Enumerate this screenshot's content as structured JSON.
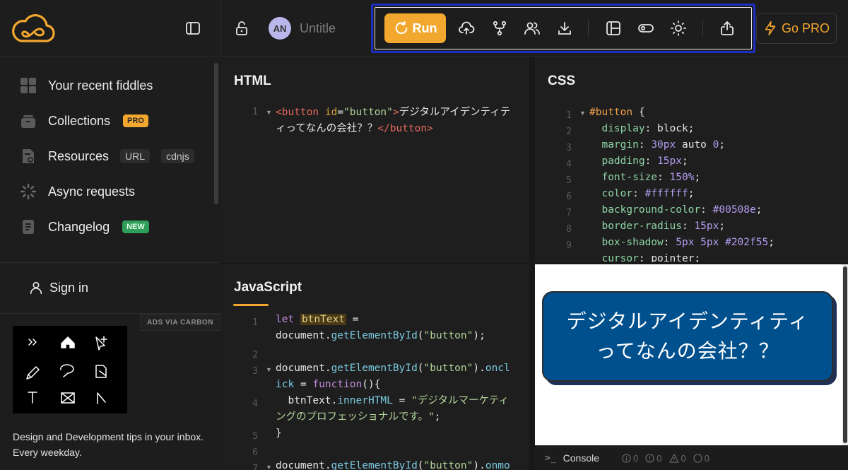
{
  "header": {
    "avatar_initials": "AN",
    "title": "Untitle",
    "run_label": "Run",
    "gopro_label": "Go PRO",
    "toolbar_icons": [
      "upload-icon",
      "fork-icon",
      "collaborate-icon",
      "download-icon",
      "layout-icon",
      "toggle-icon",
      "theme-sun-icon",
      "share-icon"
    ]
  },
  "sidebar": {
    "items": [
      {
        "label": "Your recent fiddles"
      },
      {
        "label": "Collections",
        "badge": "PRO"
      },
      {
        "label": "Resources",
        "chips": [
          "URL",
          "cdnjs"
        ]
      },
      {
        "label": "Async requests"
      },
      {
        "label": "Changelog",
        "badge": "NEW"
      }
    ],
    "signin_label": "Sign in",
    "ads_label": "ADS VIA CARBON",
    "ad_text": "Design and Development tips in your inbox. Every weekday."
  },
  "panels": {
    "html_title": "HTML",
    "css_title": "CSS",
    "js_title": "JavaScript"
  },
  "console": {
    "label": "Console",
    "counts": [
      "0",
      "0",
      "0",
      "0"
    ]
  },
  "preview": {
    "button_line1": "デジタルアイデンティティ",
    "button_line2": "ってなんの会社？？"
  },
  "colors": {
    "accent": "#f2a72e",
    "highlight_border": "#1e2fc4",
    "preview_button_bg": "#00508e"
  }
}
